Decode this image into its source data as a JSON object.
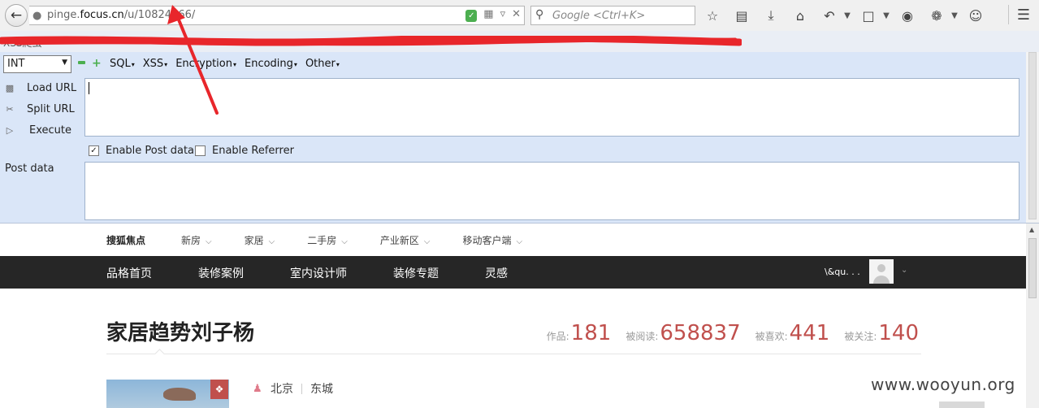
{
  "browser": {
    "url_prefix": "pinge.",
    "url_domain": "focus.cn",
    "url_path": "/u/10824366/",
    "search_placeholder": "Google <Ctrl+K>",
    "bookmark_fragment": "XSS爬虫"
  },
  "hackbar": {
    "select_value": "INT",
    "menus": [
      "SQL",
      "XSS",
      "Encryption",
      "Encoding",
      "Other"
    ],
    "load_url": "Load URL",
    "split_url": "Split URL",
    "execute": "Execute",
    "enable_post": "Enable Post data",
    "enable_referrer": "Enable Referrer",
    "post_label": "Post data",
    "url_value": "",
    "post_value": "",
    "side_minus": "-",
    "side_plus": "+"
  },
  "site": {
    "subnav": {
      "brand": "搜狐焦点",
      "items": [
        "新房",
        "家居",
        "二手房",
        "产业新区",
        "移动客户端"
      ]
    },
    "mainnav": [
      "品格首页",
      "装修案例",
      "室内设计师",
      "装修专题",
      "灵感"
    ],
    "user_name": "\\&qu. . .",
    "profile_name": "家居趋势刘子杨",
    "stats": [
      {
        "label": "作品:",
        "value": "181"
      },
      {
        "label": "被阅读:",
        "value": "658837"
      },
      {
        "label": "被喜欢:",
        "value": "441"
      },
      {
        "label": "被关注:",
        "value": "140"
      }
    ],
    "location": {
      "city": "北京",
      "district": "东城"
    },
    "watermark": "www.wooyun.org"
  },
  "colors": {
    "accent_red": "#c0504d",
    "nav_dark": "#262626",
    "hackbar_bg": "#dae6f8",
    "annotation": "#e8262b"
  }
}
